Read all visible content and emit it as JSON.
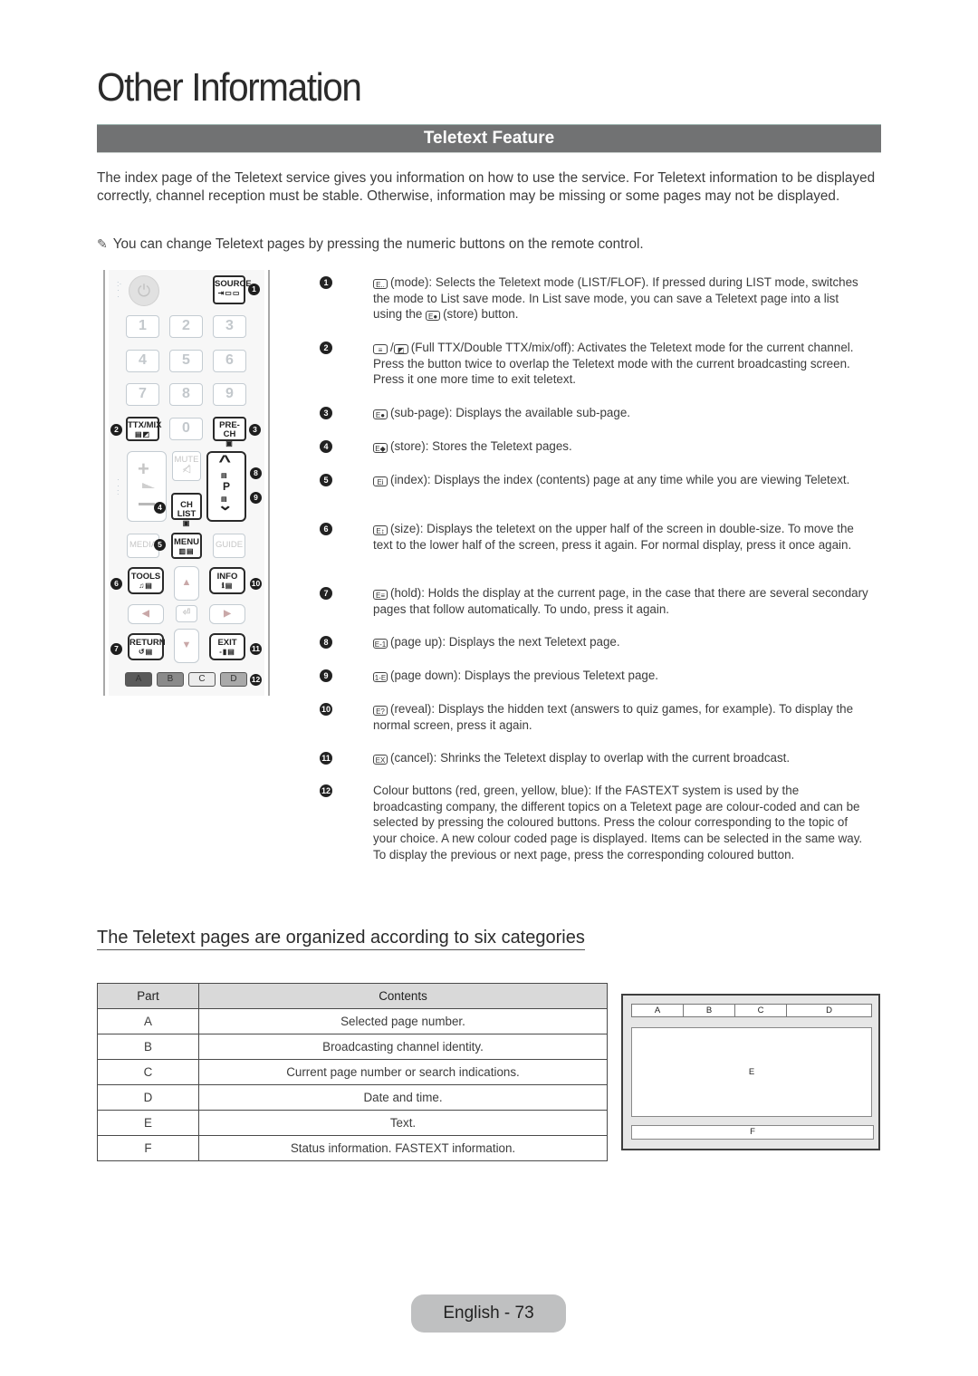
{
  "page": {
    "title": "Other Information",
    "section_title": "Teletext Feature",
    "intro": "The index page of the Teletext service gives you information on how to use the service. For Teletext information to be displayed correctly, channel reception must be stable. Otherwise, information may be missing or some pages may not be displayed.",
    "note_icon": "pencil-icon",
    "note": "You can change Teletext pages by pressing the numeric buttons on the remote control."
  },
  "remote": {
    "source": "SOURCE",
    "numbers": [
      "1",
      "2",
      "3",
      "4",
      "5",
      "6",
      "7",
      "8",
      "9",
      "0"
    ],
    "ttx": "TTX/MIX",
    "prech": "PRE-CH",
    "mute": "MUTE",
    "chlist": "CH LIST",
    "p": "P",
    "media": "MEDIA",
    "menu": "MENU",
    "guide": "GUIDE",
    "tools": "TOOLS",
    "info": "INFO",
    "return": "RETURN",
    "exit": "EXIT",
    "colors": [
      "A",
      "B",
      "C",
      "D"
    ],
    "color_fills": [
      "#5a5a5a",
      "#8a8a8a",
      "#ececec",
      "#a9a9a9"
    ],
    "badges": [
      "1",
      "2",
      "3",
      "4",
      "5",
      "6",
      "7",
      "8",
      "9",
      "10",
      "11",
      "12"
    ]
  },
  "items": [
    {
      "num": "1",
      "icon": "E..",
      "text": "(mode): Selects the Teletext mode (LIST/FLOF). If pressed during LIST mode, switches the mode to List save mode. In List save mode, you can save a Teletext page into a list using the",
      "icon2": "E●",
      "text2": "(store) button."
    },
    {
      "num": "2",
      "icon": "≡",
      "icon_b": "◩",
      "text": "(Full TTX/Double TTX/mix/off): Activates the Teletext mode for the current channel. Press the button twice to overlap the Teletext mode with the current broadcasting screen. Press it one more time to exit teletext."
    },
    {
      "num": "3",
      "icon": "E●",
      "text": "(sub-page): Displays the available sub-page."
    },
    {
      "num": "4",
      "icon": "E◆",
      "text": "(store): Stores the Teletext pages."
    },
    {
      "num": "5",
      "icon": "Ei",
      "text": "(index): Displays the index (contents) page at any time while you are viewing Teletext."
    },
    {
      "num": "6",
      "icon": "E↕",
      "text": "(size): Displays the teletext on the upper half of the screen in double-size. To move the text to the lower half of the screen, press it again. For normal display, press it once again."
    },
    {
      "num": "7",
      "icon": "E≡",
      "text": "(hold): Holds the display at the current page, in the case that there are several secondary pages that follow automatically. To undo, press it again."
    },
    {
      "num": "8",
      "icon": "E-1",
      "text": "(page up): Displays the next Teletext page."
    },
    {
      "num": "9",
      "icon": "1-E",
      "text": "(page down): Displays the previous Teletext page."
    },
    {
      "num": "10",
      "icon": "E?",
      "text": "(reveal): Displays the hidden text (answers to quiz games, for example). To display the normal screen, press it again."
    },
    {
      "num": "11",
      "icon": "EX",
      "text": "(cancel): Shrinks the Teletext display to overlap with the current broadcast."
    },
    {
      "num": "12",
      "text": "Colour buttons (red, green, yellow, blue): If the FASTEXT system is used by the broadcasting company, the different topics on a Teletext page are colour-coded and can be selected by pressing the coloured buttons. Press the colour corresponding to the topic of your choice. A new colour coded page is displayed. Items can be selected in the same way. To display the previous or next page, press the corresponding coloured button."
    }
  ],
  "categories": {
    "heading": "The Teletext pages are organized according to six categories",
    "columns": [
      "Part",
      "Contents"
    ],
    "rows": [
      {
        "part": "A",
        "contents": "Selected page number."
      },
      {
        "part": "B",
        "contents": "Broadcasting channel identity."
      },
      {
        "part": "C",
        "contents": "Current page number or search indications."
      },
      {
        "part": "D",
        "contents": "Date and time."
      },
      {
        "part": "E",
        "contents": "Text."
      },
      {
        "part": "F",
        "contents": "Status information. FASTEXT information."
      }
    ]
  },
  "diagram": {
    "top": [
      "A",
      "B",
      "C",
      "D"
    ],
    "middle": "E",
    "bottom": "F"
  },
  "footer": {
    "page_label": "English - 73"
  }
}
